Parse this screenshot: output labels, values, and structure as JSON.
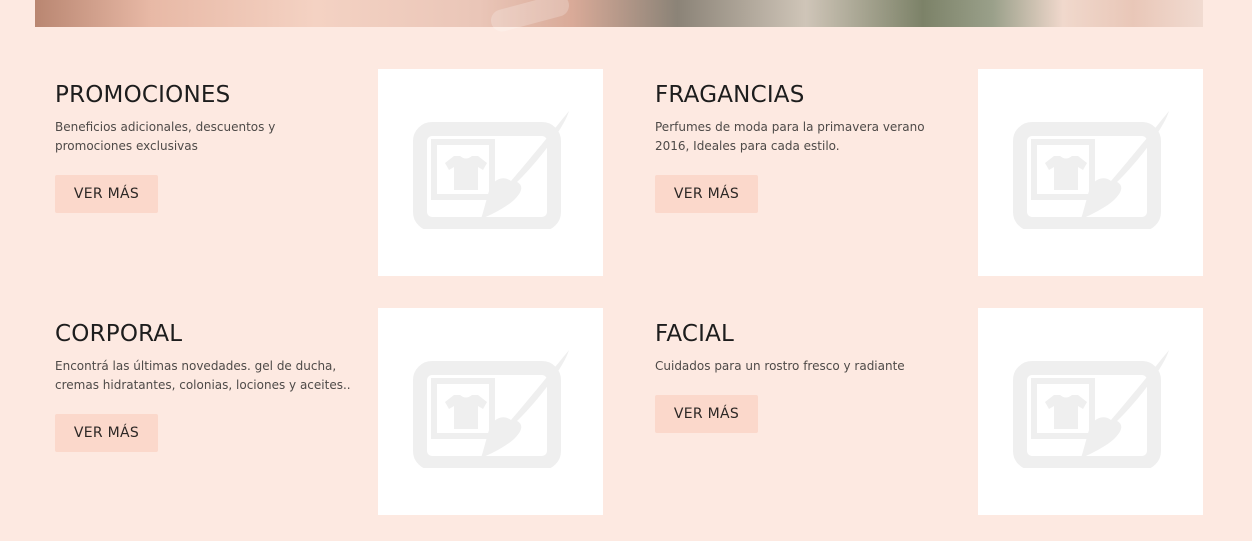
{
  "hero": {
    "image": "hero-banner-image"
  },
  "categories": [
    {
      "title": "PROMOCIONES",
      "description": "Beneficios adicionales, descuentos y promociones exclusivas",
      "button_label": "VER MÁS",
      "image_icon": "image-placeholder-icon"
    },
    {
      "title": "FRAGANCIAS",
      "description": "Perfumes de moda para la primavera verano 2016, Ideales para cada estilo.",
      "button_label": "VER MÁS",
      "image_icon": "image-placeholder-icon"
    },
    {
      "title": "CORPORAL",
      "description": "Encontrá las últimas novedades. gel de ducha, cremas hidratantes, colonias, lociones y aceites..",
      "button_label": "VER MÁS",
      "image_icon": "image-placeholder-icon"
    },
    {
      "title": "FACIAL",
      "description": "Cuidados para un rostro fresco y radiante",
      "button_label": "VER MÁS",
      "image_icon": "image-placeholder-icon"
    }
  ],
  "colors": {
    "page_background": "#fde9e1",
    "button_background": "#fbd8cb",
    "placeholder_icon": "#efefef"
  }
}
